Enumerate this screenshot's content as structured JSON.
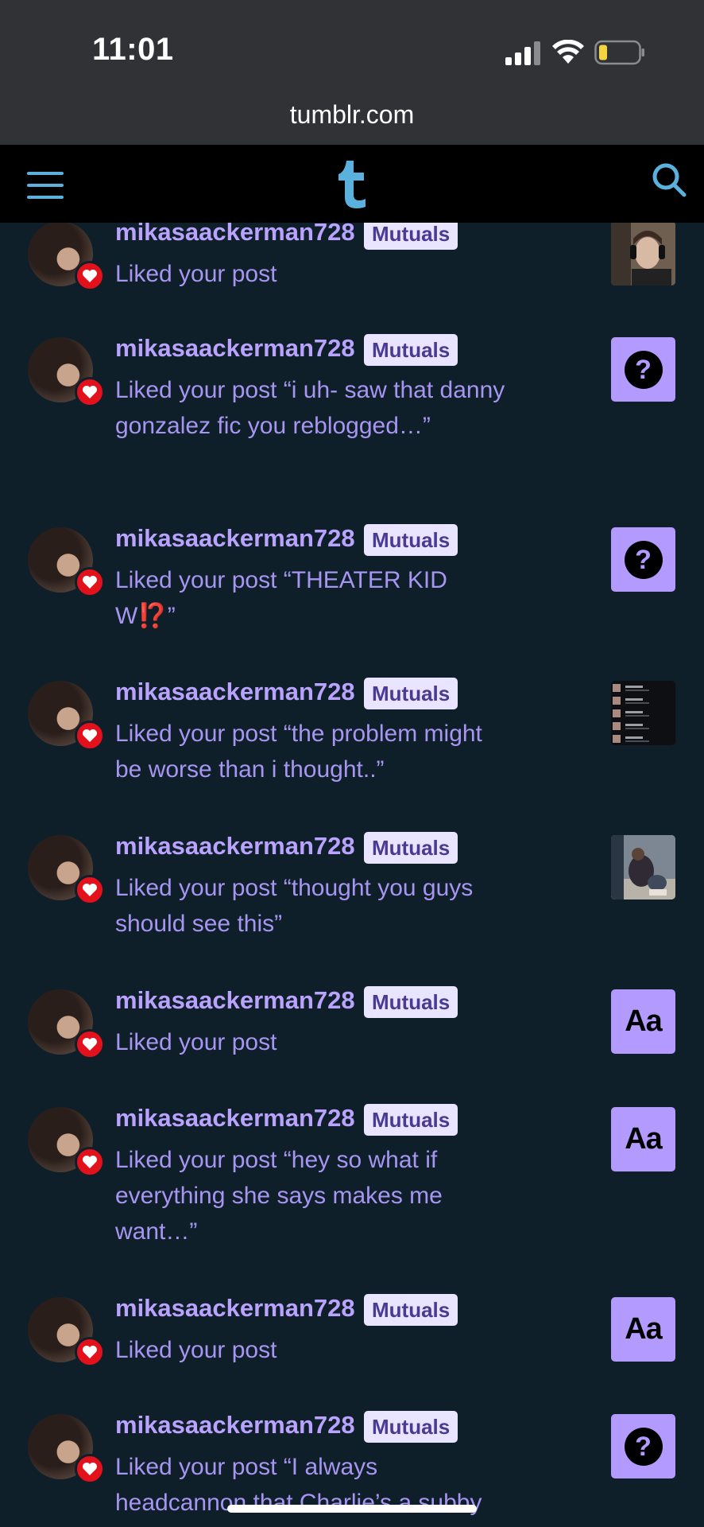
{
  "status_bar": {
    "time": "11:01"
  },
  "browser": {
    "url": "tumblr.com"
  },
  "nav": {
    "menu_icon": "hamburger-menu-icon",
    "logo_icon": "tumblr-t-logo-icon",
    "search_icon": "search-icon"
  },
  "colors": {
    "background": "#0f1f29",
    "accent_purple": "#b9a3ff",
    "heart_red": "#e2111c",
    "logo_blue": "#5ab1de"
  },
  "notifications": [
    {
      "username": "mikasaackerman728",
      "badge": "Mutuals",
      "message": "Liked your post",
      "thumbnail": "photo-person-headphones"
    },
    {
      "username": "mikasaackerman728",
      "badge": "Mutuals",
      "message": "Liked your post “i uh- saw that danny gonzalez fic you reblogged…”",
      "thumbnail": "question-icon"
    },
    {
      "username": "mikasaackerman728",
      "badge": "Mutuals",
      "message_prefix": "Liked your post “THEATER KID W",
      "message_emoji": "⁉️",
      "message_suffix": "”",
      "thumbnail": "question-icon"
    },
    {
      "username": "mikasaackerman728",
      "badge": "Mutuals",
      "message": "Liked your post “the problem might be worse than i thought..”",
      "thumbnail": "photo-list-screenshot"
    },
    {
      "username": "mikasaackerman728",
      "badge": "Mutuals",
      "message": "Liked your post “thought you guys should see this”",
      "thumbnail": "photo-people-floor"
    },
    {
      "username": "mikasaackerman728",
      "badge": "Mutuals",
      "message": "Liked your post",
      "thumbnail": "Aa"
    },
    {
      "username": "mikasaackerman728",
      "badge": "Mutuals",
      "message": "Liked your post “hey so what if everything she says makes me want…”",
      "thumbnail": "Aa"
    },
    {
      "username": "mikasaackerman728",
      "badge": "Mutuals",
      "message": "Liked your post",
      "thumbnail": "Aa"
    },
    {
      "username": "mikasaackerman728",
      "badge": "Mutuals",
      "message": "Liked your post “I always headcannon that Charlie’s a subby",
      "thumbnail": "question-icon"
    }
  ]
}
